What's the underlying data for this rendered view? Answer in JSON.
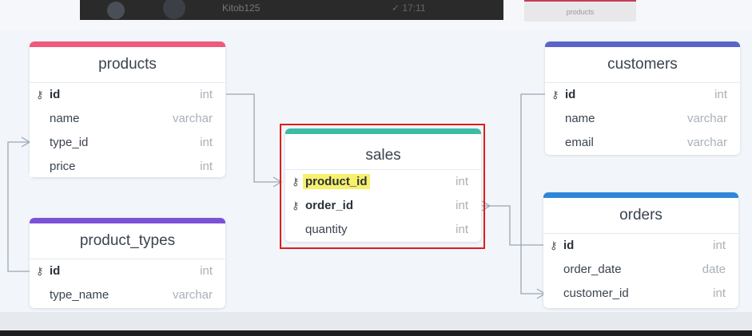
{
  "topbar": {
    "username": "Kitob125",
    "check_text": "✓ 17:11",
    "tab_label": "products"
  },
  "colors": {
    "products": "#ef5a7a",
    "customers": "#5a64c8",
    "sales": "#3dbba6",
    "product_types": "#7b52d6",
    "orders": "#2f86d8",
    "selection": "#e01c1c",
    "highlight": "#f7f06d"
  },
  "tables": {
    "products": {
      "title": "products",
      "fields": [
        {
          "name": "id",
          "type": "int",
          "key": true
        },
        {
          "name": "name",
          "type": "varchar",
          "key": false
        },
        {
          "name": "type_id",
          "type": "int",
          "key": false
        },
        {
          "name": "price",
          "type": "int",
          "key": false
        }
      ]
    },
    "customers": {
      "title": "customers",
      "fields": [
        {
          "name": "id",
          "type": "int",
          "key": true
        },
        {
          "name": "name",
          "type": "varchar",
          "key": false
        },
        {
          "name": "email",
          "type": "varchar",
          "key": false
        }
      ]
    },
    "sales": {
      "title": "sales",
      "fields": [
        {
          "name": "product_id",
          "type": "int",
          "key": true,
          "highlighted": true
        },
        {
          "name": "order_id",
          "type": "int",
          "key": true
        },
        {
          "name": "quantity",
          "type": "int",
          "key": false
        }
      ]
    },
    "product_types": {
      "title": "product_types",
      "fields": [
        {
          "name": "id",
          "type": "int",
          "key": true
        },
        {
          "name": "type_name",
          "type": "varchar",
          "key": false
        }
      ]
    },
    "orders": {
      "title": "orders",
      "fields": [
        {
          "name": "id",
          "type": "int",
          "key": true
        },
        {
          "name": "order_date",
          "type": "date",
          "key": false
        },
        {
          "name": "customer_id",
          "type": "int",
          "key": false
        }
      ]
    }
  }
}
